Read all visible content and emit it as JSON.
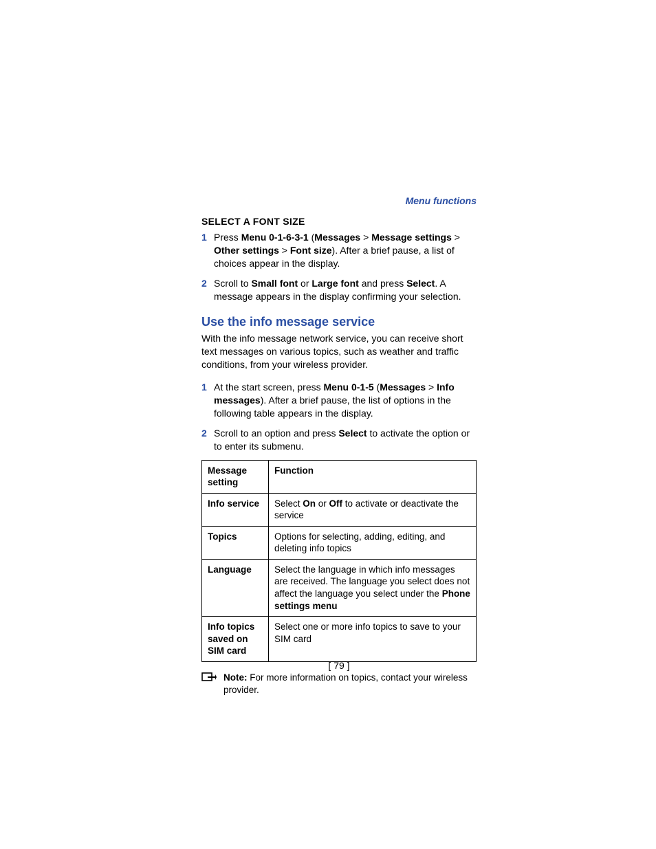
{
  "runningHeader": "Menu functions",
  "subhead1": "SELECT A FONT SIZE",
  "step1": {
    "num": "1",
    "parts": [
      "Press ",
      "Menu 0-1-6-3-1",
      " (",
      "Messages",
      " > ",
      "Message settings",
      " > ",
      "Other settings",
      " > ",
      "Font size",
      "). After a brief pause, a list of choices appear in the display."
    ]
  },
  "step2": {
    "num": "2",
    "parts": [
      "Scroll to ",
      "Small font",
      " or ",
      "Large font",
      " and press ",
      "Select",
      ". A message appears in the display confirming your selection."
    ]
  },
  "heading2": "Use the info message service",
  "intro2": "With the info message network service, you can receive short text messages on various topics, such as weather and traffic conditions, from your wireless provider.",
  "step3": {
    "num": "1",
    "parts": [
      "At the start screen, press ",
      "Menu 0-1-5",
      " (",
      "Messages",
      " > ",
      "Info messages",
      "). After a brief pause, the list of options in the following table appears in the display."
    ]
  },
  "step4": {
    "num": "2",
    "parts": [
      "Scroll to an option and press ",
      "Select",
      " to activate the option or to enter its submenu."
    ]
  },
  "tableHead": {
    "c1": "Message setting",
    "c2": "Function"
  },
  "tableRows": [
    {
      "c1": "Info service",
      "c2parts": [
        "Select ",
        "On",
        " or ",
        "Off",
        " to activate or deactivate the service"
      ]
    },
    {
      "c1": "Topics",
      "c2parts": [
        "Options for selecting, adding, editing, and deleting info topics"
      ]
    },
    {
      "c1": "Language",
      "c2parts": [
        "Select the language in which info messages are received. The language you select does not affect the language you select under the ",
        "Phone settings menu"
      ]
    },
    {
      "c1": "Info topics saved on SIM card",
      "c2parts": [
        "Select one or more info topics to save to your SIM card"
      ]
    }
  ],
  "noteLabel": "Note:",
  "noteText": " For more information on topics, contact your wireless provider.",
  "pageNum": "[ 79 ]"
}
